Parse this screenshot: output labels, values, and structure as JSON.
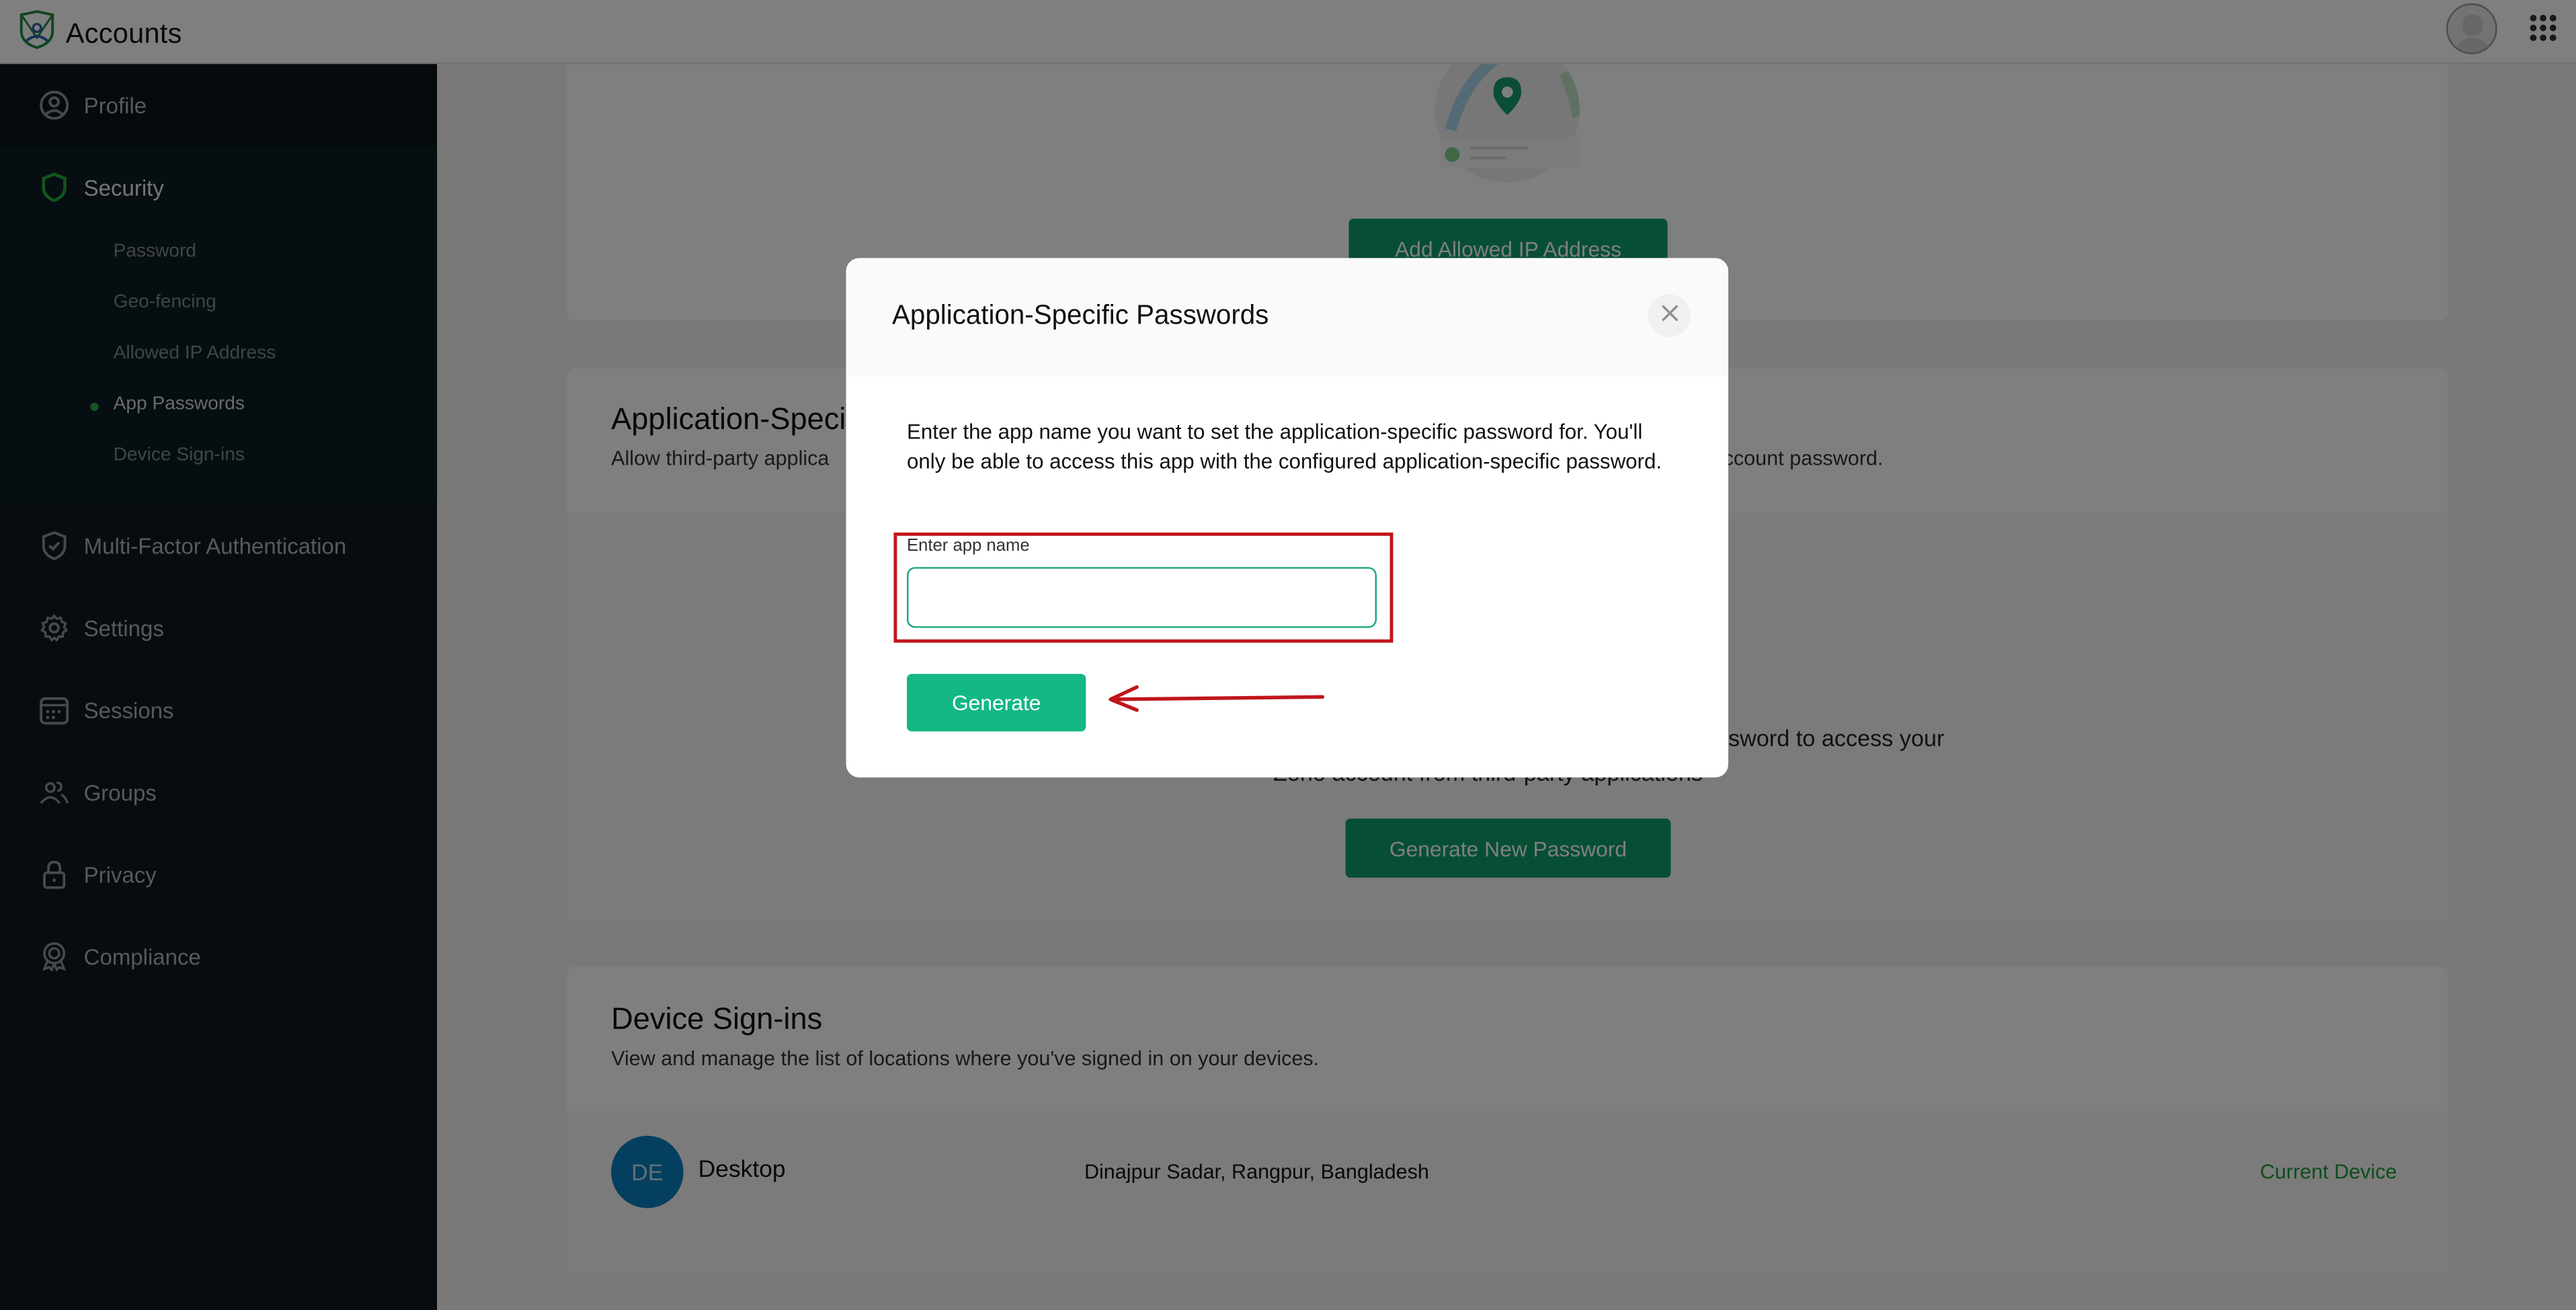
{
  "header": {
    "app_title": "Accounts",
    "logo_icon": "accounts-shield-logo-icon",
    "avatar_icon": "user-avatar-icon",
    "apps_icon": "apps-grid-icon"
  },
  "sidebar": {
    "items": [
      {
        "label": "Profile",
        "icon": "profile-icon"
      },
      {
        "label": "Security",
        "icon": "shield-icon",
        "active": true,
        "sub_items": [
          {
            "label": "Password"
          },
          {
            "label": "Geo-fencing"
          },
          {
            "label": "Allowed IP Address"
          },
          {
            "label": "App Passwords",
            "active": true
          },
          {
            "label": "Device Sign-ins"
          }
        ]
      },
      {
        "label": "Multi-Factor Authentication",
        "icon": "shield-check-icon"
      },
      {
        "label": "Settings",
        "icon": "gear-icon"
      },
      {
        "label": "Sessions",
        "icon": "calendar-icon"
      },
      {
        "label": "Groups",
        "icon": "users-icon"
      },
      {
        "label": "Privacy",
        "icon": "lock-icon"
      },
      {
        "label": "Compliance",
        "icon": "badge-icon"
      }
    ]
  },
  "main": {
    "allowed_ip": {
      "illustration": "map-pin-illustration",
      "button_label": "Add Allowed IP Address"
    },
    "app_passwords": {
      "title": "Application-Specific Passwords",
      "description_visible_left": "Allow third-party applica",
      "description_visible_right": "ccount password.",
      "empty_text_line1_visible": "ssword to access your",
      "empty_text_line2_visible": "Zoho account from third-party applications",
      "button_label": "Generate New Password"
    },
    "device_signins": {
      "title": "Device Sign-ins",
      "description": "View and manage the list of locations where you've signed in on your devices.",
      "devices": [
        {
          "initials": "DE",
          "name": "Desktop",
          "location": "Dinajpur Sadar, Rangpur, Bangladesh",
          "status": "Current Device"
        }
      ]
    }
  },
  "modal": {
    "title": "Application-Specific Passwords",
    "close_icon": "close-icon",
    "description": "Enter the app name you want to set the application-specific password for. You'll only be able to access this app with the configured application-specific password.",
    "field_label": "Enter app name",
    "field_value": "",
    "field_placeholder": "",
    "generate_label": "Generate"
  },
  "annotations": {
    "highlight_color": "#c0161c",
    "arrow_color": "#c0161c"
  },
  "colors": {
    "brand_green": "#13b884",
    "sidebar_bg": "#0c1820",
    "current_device": "#1d9a3a",
    "avatar_blue": "#0a7fbf"
  }
}
